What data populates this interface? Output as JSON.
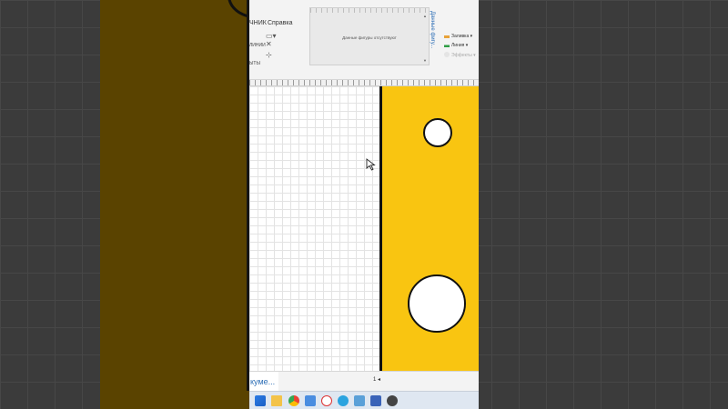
{
  "ribbon": {
    "help_tab": "Справка",
    "tab_fragment": "ЧНИК",
    "lines_fragment": "ЛИНИИ",
    "shapes_fragment": "ЫТЫ",
    "data_panel_text": "Данные фигуры отсутствуют",
    "vertical_caption": "Данные фигу...",
    "fill_label": "Заливка",
    "line_label": "Линия",
    "effects_label": "Эффекты"
  },
  "statusbar": {
    "document_tab": "куме...",
    "page_indicator": "1"
  },
  "colors": {
    "shape_fill": "#f9c511",
    "shape_outline": "#111111",
    "overlay": "#5a4300",
    "accent": "#2e6fb6"
  },
  "taskbar": {
    "icons": [
      "windows-start-icon",
      "file-explorer-icon",
      "chrome-icon",
      "app-icon",
      "yandex-browser-icon",
      "telegram-icon",
      "notepad-icon",
      "visio-icon",
      "other-app-icon"
    ]
  }
}
